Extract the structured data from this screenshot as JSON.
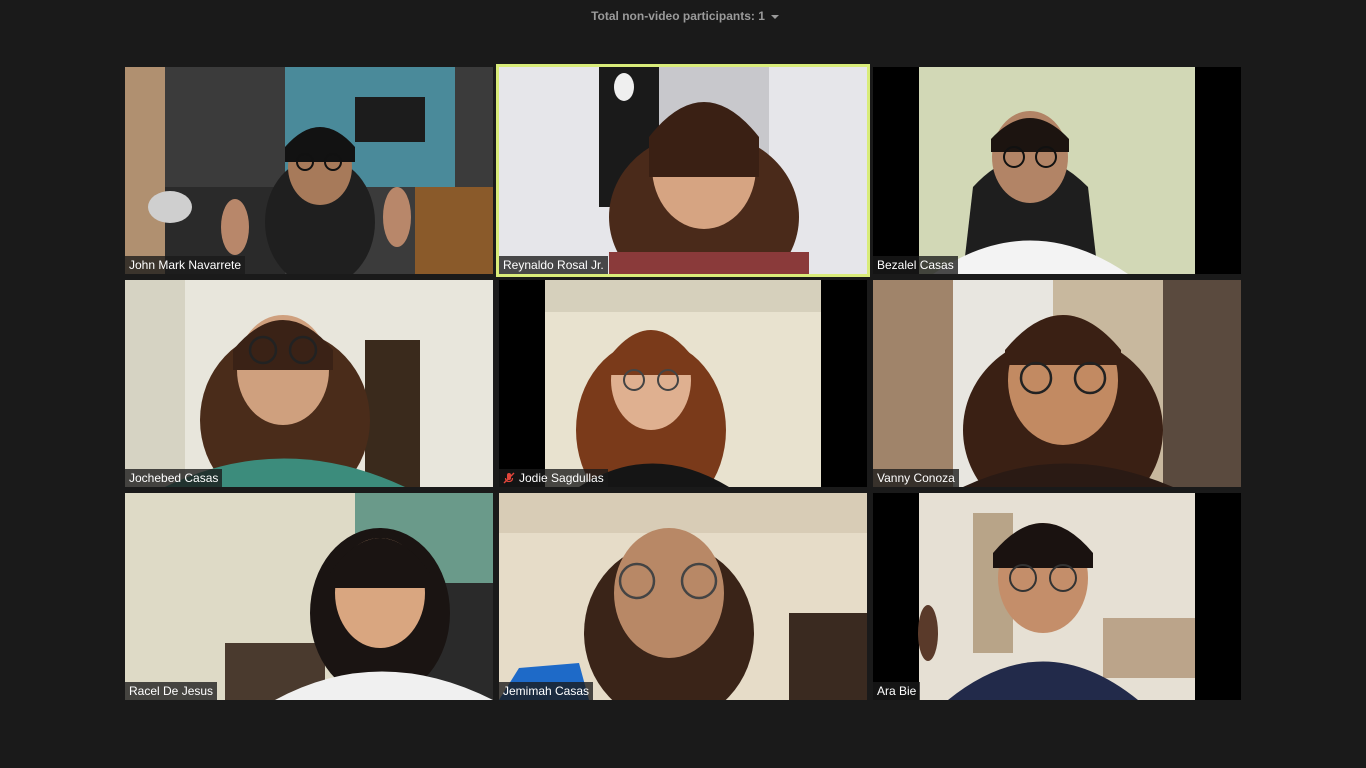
{
  "header": {
    "non_video_label": "Total non-video participants: 1"
  },
  "participants": [
    {
      "name": "John Mark Navarrete"
    },
    {
      "name": "Reynaldo Rosal Jr."
    },
    {
      "name": "Bezalel Casas"
    },
    {
      "name": "Jochebed Casas"
    },
    {
      "name": "Jodie Sagdullas",
      "muted": true
    },
    {
      "name": "Vanny Conoza"
    },
    {
      "name": "Racel De Jesus"
    },
    {
      "name": "Jemimah Casas"
    },
    {
      "name": "Ara Bie"
    }
  ],
  "colors": {
    "background": "#1a1a1a",
    "active_speaker_border": "#d9ec7a",
    "mute_icon": "#e0453a"
  },
  "icons": {
    "non_video_dropdown": "chevron-down-icon",
    "muted_mic": "mic-muted-icon"
  }
}
